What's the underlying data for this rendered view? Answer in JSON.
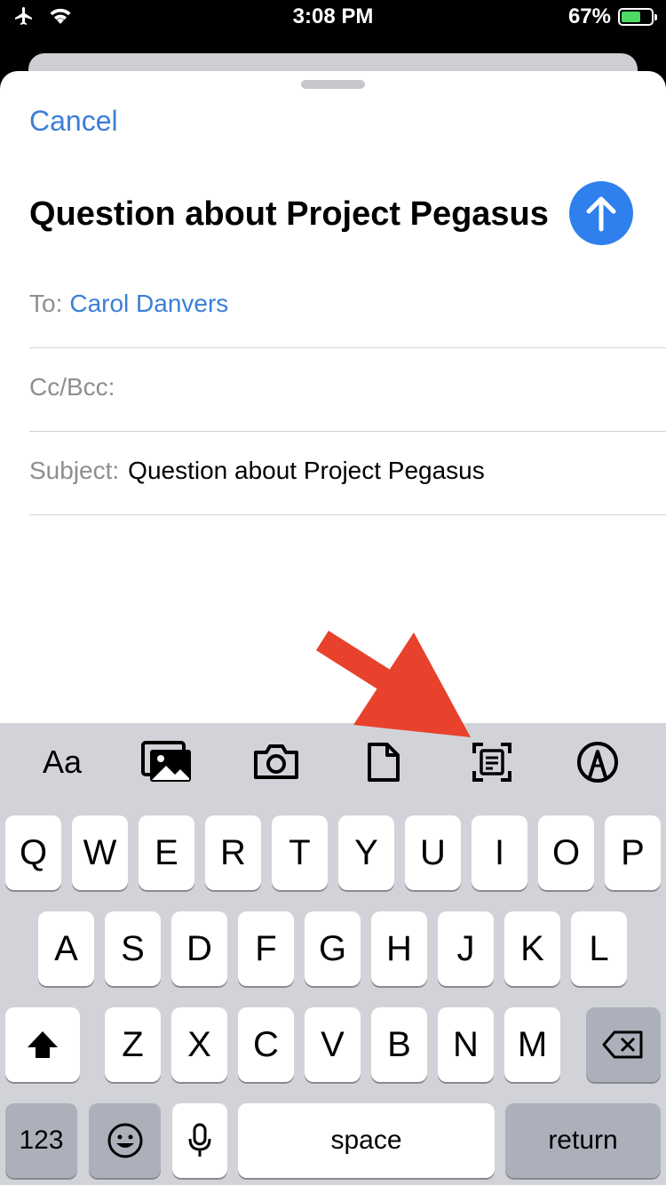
{
  "status_bar": {
    "time": "3:08 PM",
    "battery": "67%",
    "battery_level": 0.67
  },
  "compose": {
    "cancel_label": "Cancel",
    "title": "Question about Project Pegasus",
    "to_label": "To:",
    "to_value": "Carol Danvers",
    "cc_label": "Cc/Bcc:",
    "subject_label": "Subject:",
    "subject_value": "Question about Project Pegasus"
  },
  "toolbar": {
    "format_label": "Aa",
    "icons": [
      "photo-library-icon",
      "camera-icon",
      "document-icon",
      "scan-document-icon",
      "markup-icon"
    ]
  },
  "keyboard": {
    "row1": [
      "Q",
      "W",
      "E",
      "R",
      "T",
      "Y",
      "U",
      "I",
      "O",
      "P"
    ],
    "row2": [
      "A",
      "S",
      "D",
      "F",
      "G",
      "H",
      "J",
      "K",
      "L"
    ],
    "row3": [
      "Z",
      "X",
      "C",
      "V",
      "B",
      "N",
      "M"
    ],
    "numbers_label": "123",
    "space_label": "space",
    "return_label": "return"
  },
  "colors": {
    "accent": "#3b7ed8",
    "send": "#2f80ed",
    "annotation": "#e8412c"
  }
}
